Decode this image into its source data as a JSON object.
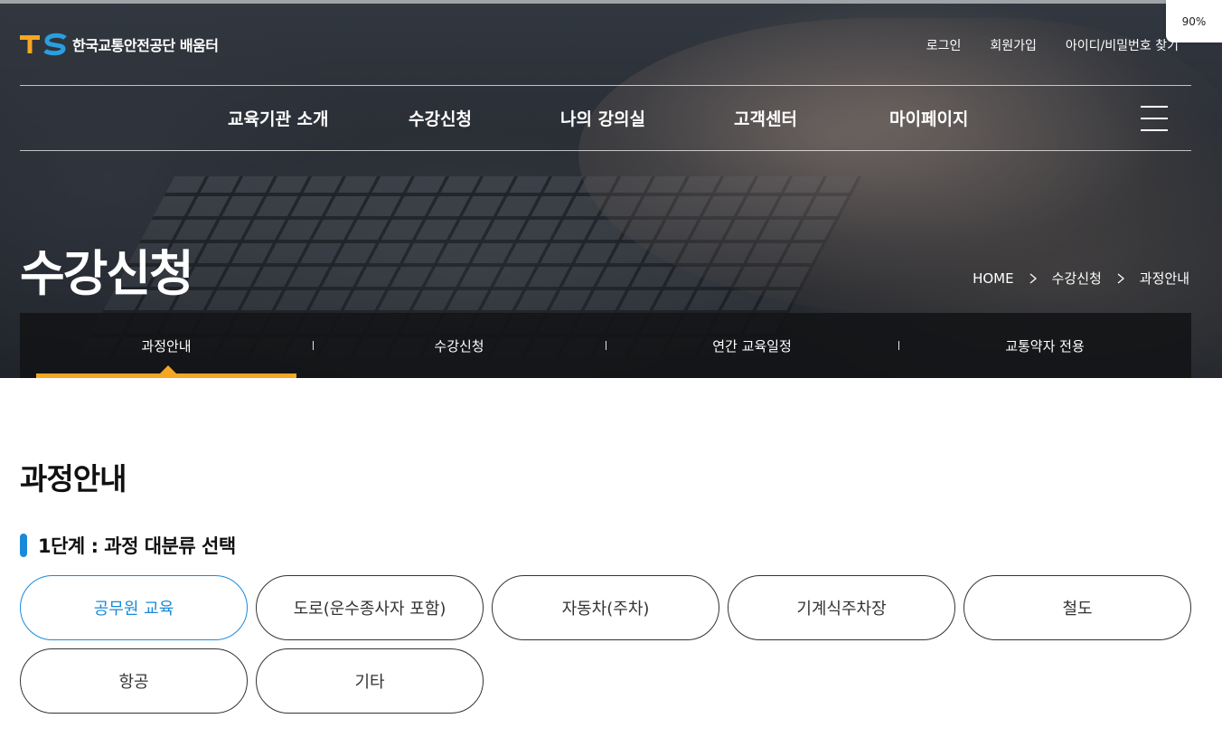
{
  "browser": {
    "zoom": "90%"
  },
  "header": {
    "logo_letters": "TS",
    "logo_text": "한국교통안전공단 배움터",
    "util_links": [
      "로그인",
      "회원가입",
      "아이디/비밀번호 찾기"
    ],
    "gnb": [
      "교육기관 소개",
      "수강신청",
      "나의 강의실",
      "고객센터",
      "마이페이지"
    ],
    "menu_icon": "hamburger-icon"
  },
  "hero": {
    "title": "수강신청",
    "breadcrumb": [
      "HOME",
      "수강신청",
      "과정안내"
    ]
  },
  "subnav": {
    "items": [
      "과정안내",
      "수강신청",
      "연간 교육일정",
      "교통약자 전용"
    ],
    "active_index": 0,
    "accent_color": "#f5a623"
  },
  "content": {
    "section_title": "과정안내",
    "step_label": "1단계 : 과정 대분류 선택",
    "categories": [
      "공무원 교육",
      "도로(운수종사자 포함)",
      "자동차(주차)",
      "기계식주차장",
      "철도",
      "항공",
      "기타"
    ],
    "selected_category_index": 0,
    "accent_color": "#1a8ad8"
  }
}
